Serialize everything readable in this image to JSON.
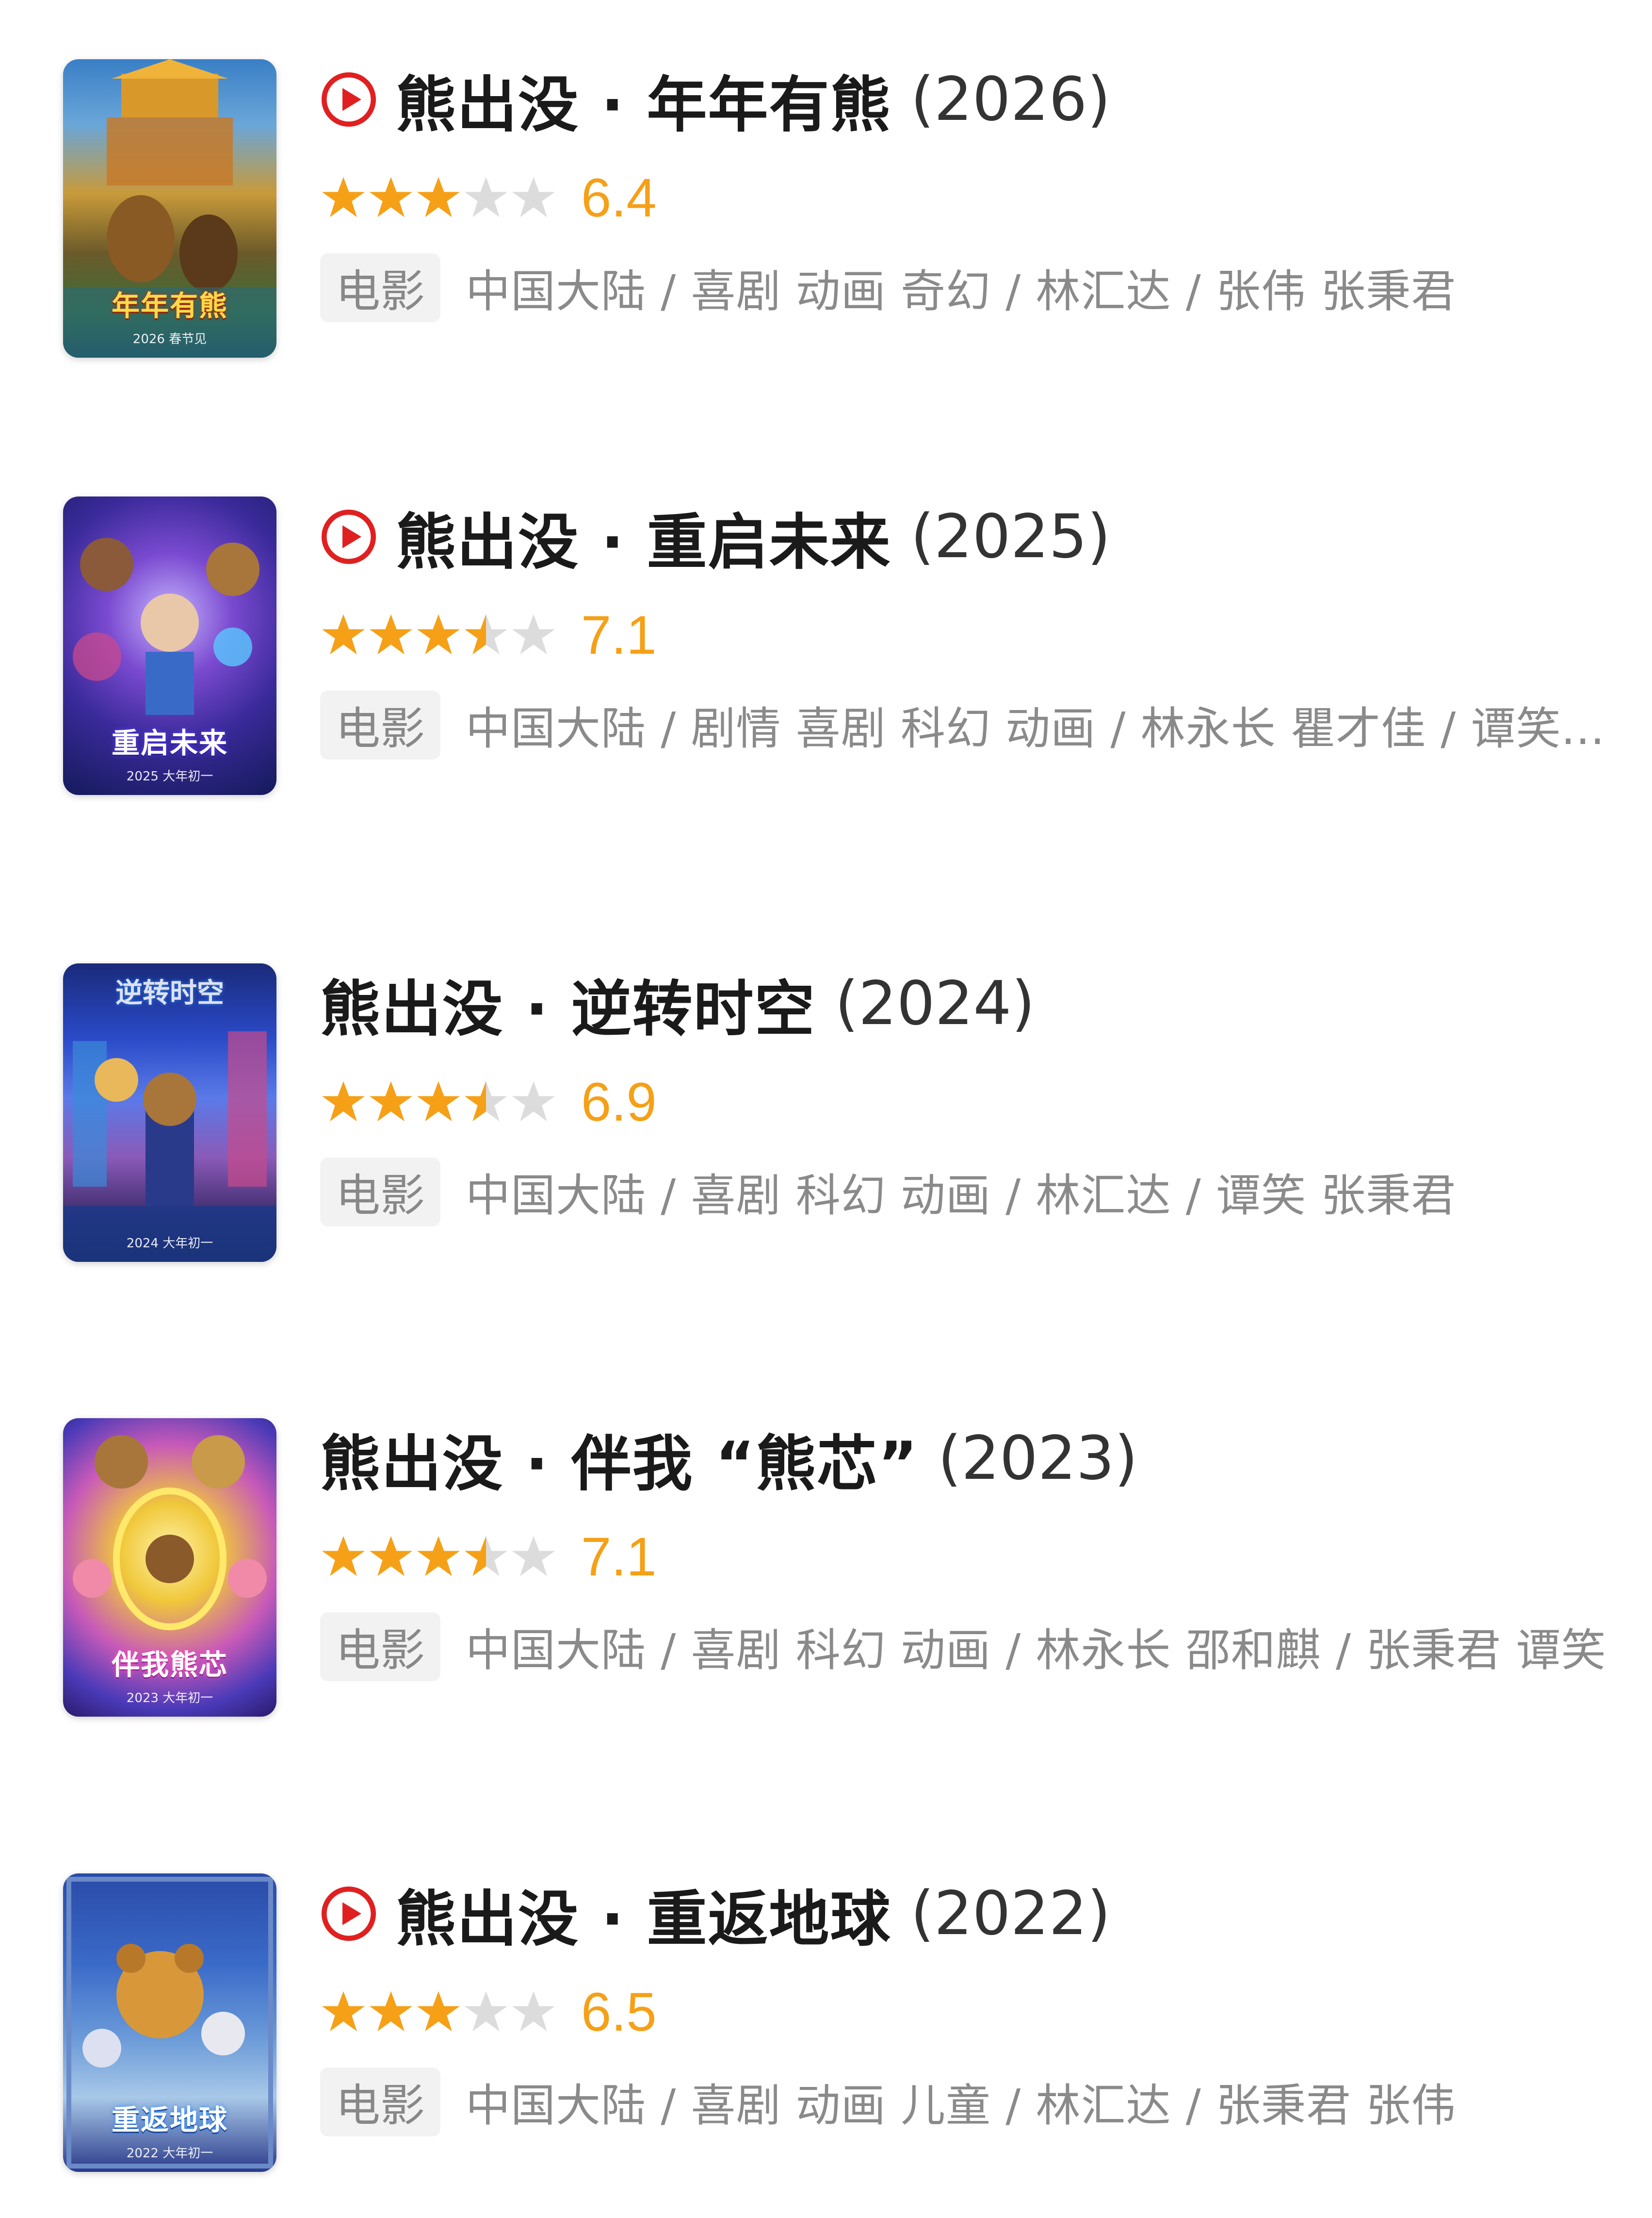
{
  "colors": {
    "star_filled": "#f5a017",
    "star_empty": "#dcdcdc",
    "score": "#f5a017",
    "play_icon": "#e02020",
    "tag_bg": "#f2f2f2",
    "meta_text": "#8a8a8a"
  },
  "movies": [
    {
      "has_play_icon": true,
      "play_icon": "play-circle-icon",
      "title": "熊出没 · 年年有熊",
      "year": "(2026)",
      "stars": 3.0,
      "score": "6.4",
      "tag": "电影",
      "meta": "中国大陆 / 喜剧 动画 奇幻 / 林汇达 / 张伟 张秉君",
      "poster_title": "年年有熊",
      "poster_sub": "2026 春节见"
    },
    {
      "has_play_icon": true,
      "play_icon": "play-circle-icon",
      "title": "熊出没 · 重启未来",
      "year": "(2025)",
      "stars": 3.5,
      "score": "7.1",
      "tag": "电影",
      "meta": "中国大陆 / 剧情 喜剧 科幻 动画 / 林永长 瞿才佳 / 谭笑...",
      "poster_title": "重启未来",
      "poster_sub": "2025 大年初一"
    },
    {
      "has_play_icon": false,
      "title": "熊出没 · 逆转时空",
      "year": "(2024)",
      "stars": 3.5,
      "score": "6.9",
      "tag": "电影",
      "meta": "中国大陆 / 喜剧 科幻 动画 / 林汇达 / 谭笑 张秉君",
      "poster_title": "逆转时空",
      "poster_sub": "2024 大年初一"
    },
    {
      "has_play_icon": false,
      "title": "熊出没 · 伴我 “熊芯”",
      "year": "(2023)",
      "stars": 3.5,
      "score": "7.1",
      "tag": "电影",
      "meta": "中国大陆 / 喜剧 科幻 动画 / 林永长 邵和麒 / 张秉君 谭笑",
      "poster_title": "伴我熊芯",
      "poster_sub": "2023 大年初一"
    },
    {
      "has_play_icon": true,
      "play_icon": "play-circle-icon",
      "title": "熊出没 · 重返地球",
      "year": "(2022)",
      "stars": 3.0,
      "score": "6.5",
      "tag": "电影",
      "meta": "中国大陆 / 喜剧 动画 儿童 / 林汇达 / 张秉君 张伟",
      "poster_title": "重返地球",
      "poster_sub": "2022 大年初一"
    }
  ]
}
